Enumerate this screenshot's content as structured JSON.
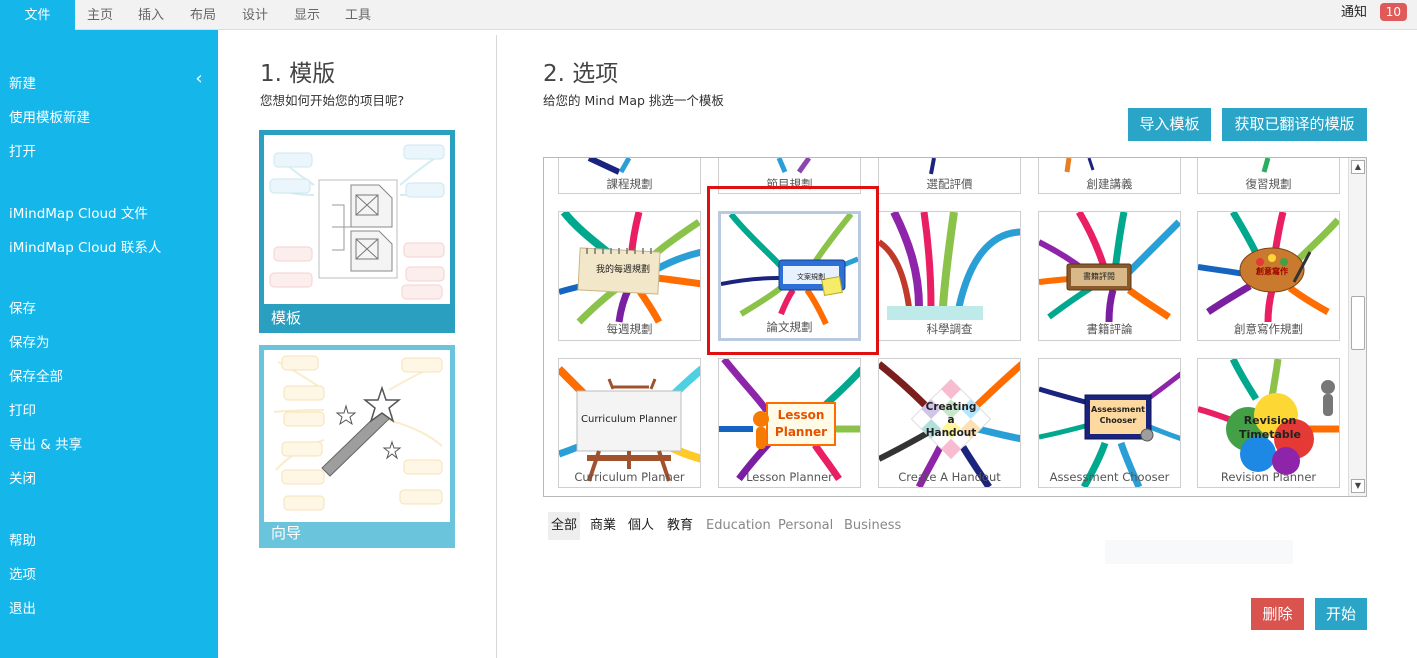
{
  "menu": {
    "tabs": [
      "文件",
      "主页",
      "插入",
      "布局",
      "设计",
      "显示",
      "工具"
    ],
    "notify_label": "通知",
    "notify_count": "10"
  },
  "sidebar": {
    "collapse_icon": "chevron-left-icon",
    "groups": [
      [
        "新建",
        "使用模板新建",
        "打开"
      ],
      [
        "iMindMap Cloud 文件",
        "iMindMap Cloud 联系人"
      ],
      [
        "保存",
        "保存为",
        "保存全部",
        "打印",
        "导出 & 共享",
        "关闭"
      ],
      [
        "帮助",
        "选项",
        "退出"
      ]
    ]
  },
  "section1": {
    "title": "1. 模版",
    "subtitle": "您想如何开始您的项目呢?",
    "cards": [
      {
        "label": "模板",
        "color": "#2a9fbf"
      },
      {
        "label": "向导",
        "color": "#69c4dc"
      }
    ]
  },
  "section2": {
    "title": "2. 选项",
    "subtitle": "给您的 Mind Map 挑选一个模板",
    "import_button": "导入模板",
    "translated_button": "获取已翻译的模版",
    "top_strip": [
      "課程規劃",
      "節目規劃",
      "選配評價",
      "創建講義",
      "復習規劃"
    ],
    "rows": [
      [
        {
          "label": "每週規劃",
          "inner": "我的每週規劃"
        },
        {
          "label": "論文規劃",
          "inner": "文案規劃",
          "selected": true
        },
        {
          "label": "科學調查",
          "inner": ""
        },
        {
          "label": "書籍評論",
          "inner": "書籍評閱"
        },
        {
          "label": "創意寫作規劃",
          "inner": "創意寫作"
        }
      ],
      [
        {
          "label": "Curriculum Planner",
          "inner": "Curriculum Planner"
        },
        {
          "label": "Lesson Planner",
          "inner": "Lesson Planner"
        },
        {
          "label": "Create A Handout",
          "inner": "Creating a Handout"
        },
        {
          "label": "Assessment Chooser",
          "inner": "Assessment Chooser"
        },
        {
          "label": "Revision Planner",
          "inner": "Revision Timetable"
        }
      ]
    ],
    "filters": [
      "全部",
      "商業",
      "個人",
      "教育",
      "Education",
      "Personal",
      "Business"
    ],
    "active_filter": "全部",
    "delete_button": "删除",
    "start_button": "开始"
  },
  "colors": {
    "accent": "#15b6ea",
    "button_blue": "#2aa5c7",
    "button_red": "#d9534f",
    "selection_outline": "#e01010"
  }
}
